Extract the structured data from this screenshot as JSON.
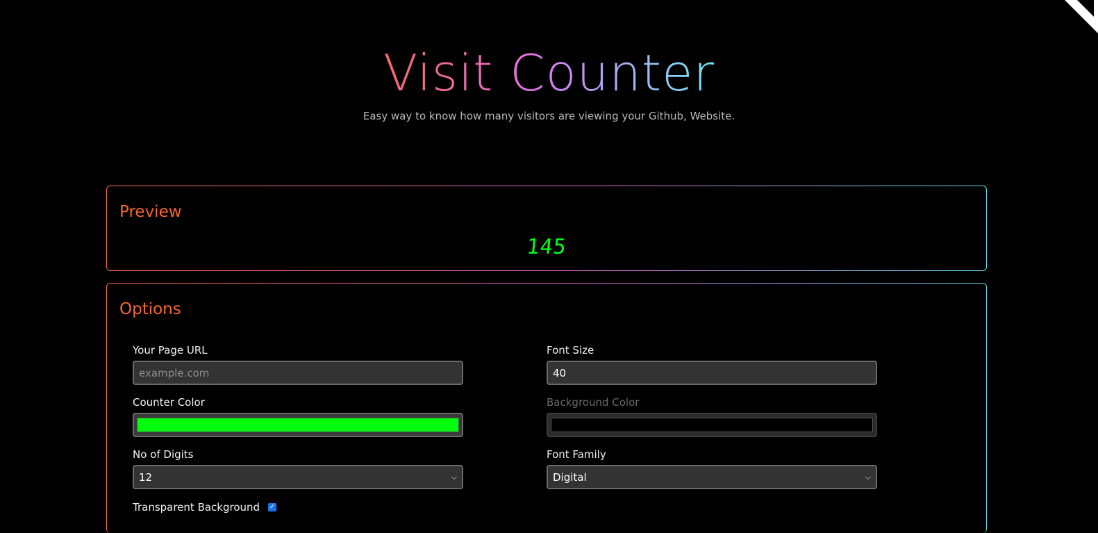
{
  "header": {
    "title": "Visit Counter",
    "subtitle": "Easy way to know how many visitors are viewing your Github, Website."
  },
  "preview": {
    "heading": "Preview",
    "counter_value": "145",
    "counter_color": "#00ff1a"
  },
  "options": {
    "heading": "Options",
    "page_url": {
      "label": "Your Page URL",
      "value": "",
      "placeholder": "example.com"
    },
    "font_size": {
      "label": "Font Size",
      "value": "40"
    },
    "counter_color": {
      "label": "Counter Color",
      "value": "#00ff0f"
    },
    "background_color": {
      "label": "Background Color",
      "value": "#000000",
      "disabled": true
    },
    "digits": {
      "label": "No of Digits",
      "selected": "12"
    },
    "font_family": {
      "label": "Font Family",
      "selected": "Digital"
    },
    "transparent": {
      "label": "Transparent Background",
      "checked": true
    }
  },
  "icons": {
    "corner": "github-corner-icon",
    "select_arrow": "chevron-down-icon",
    "check": "checkmark-icon"
  },
  "colors": {
    "heading_accent": "#f8662a",
    "gradient": [
      "#f66a6a",
      "#ee6bc8",
      "#d57df3",
      "#a3b4f4",
      "#71e7f5"
    ]
  }
}
